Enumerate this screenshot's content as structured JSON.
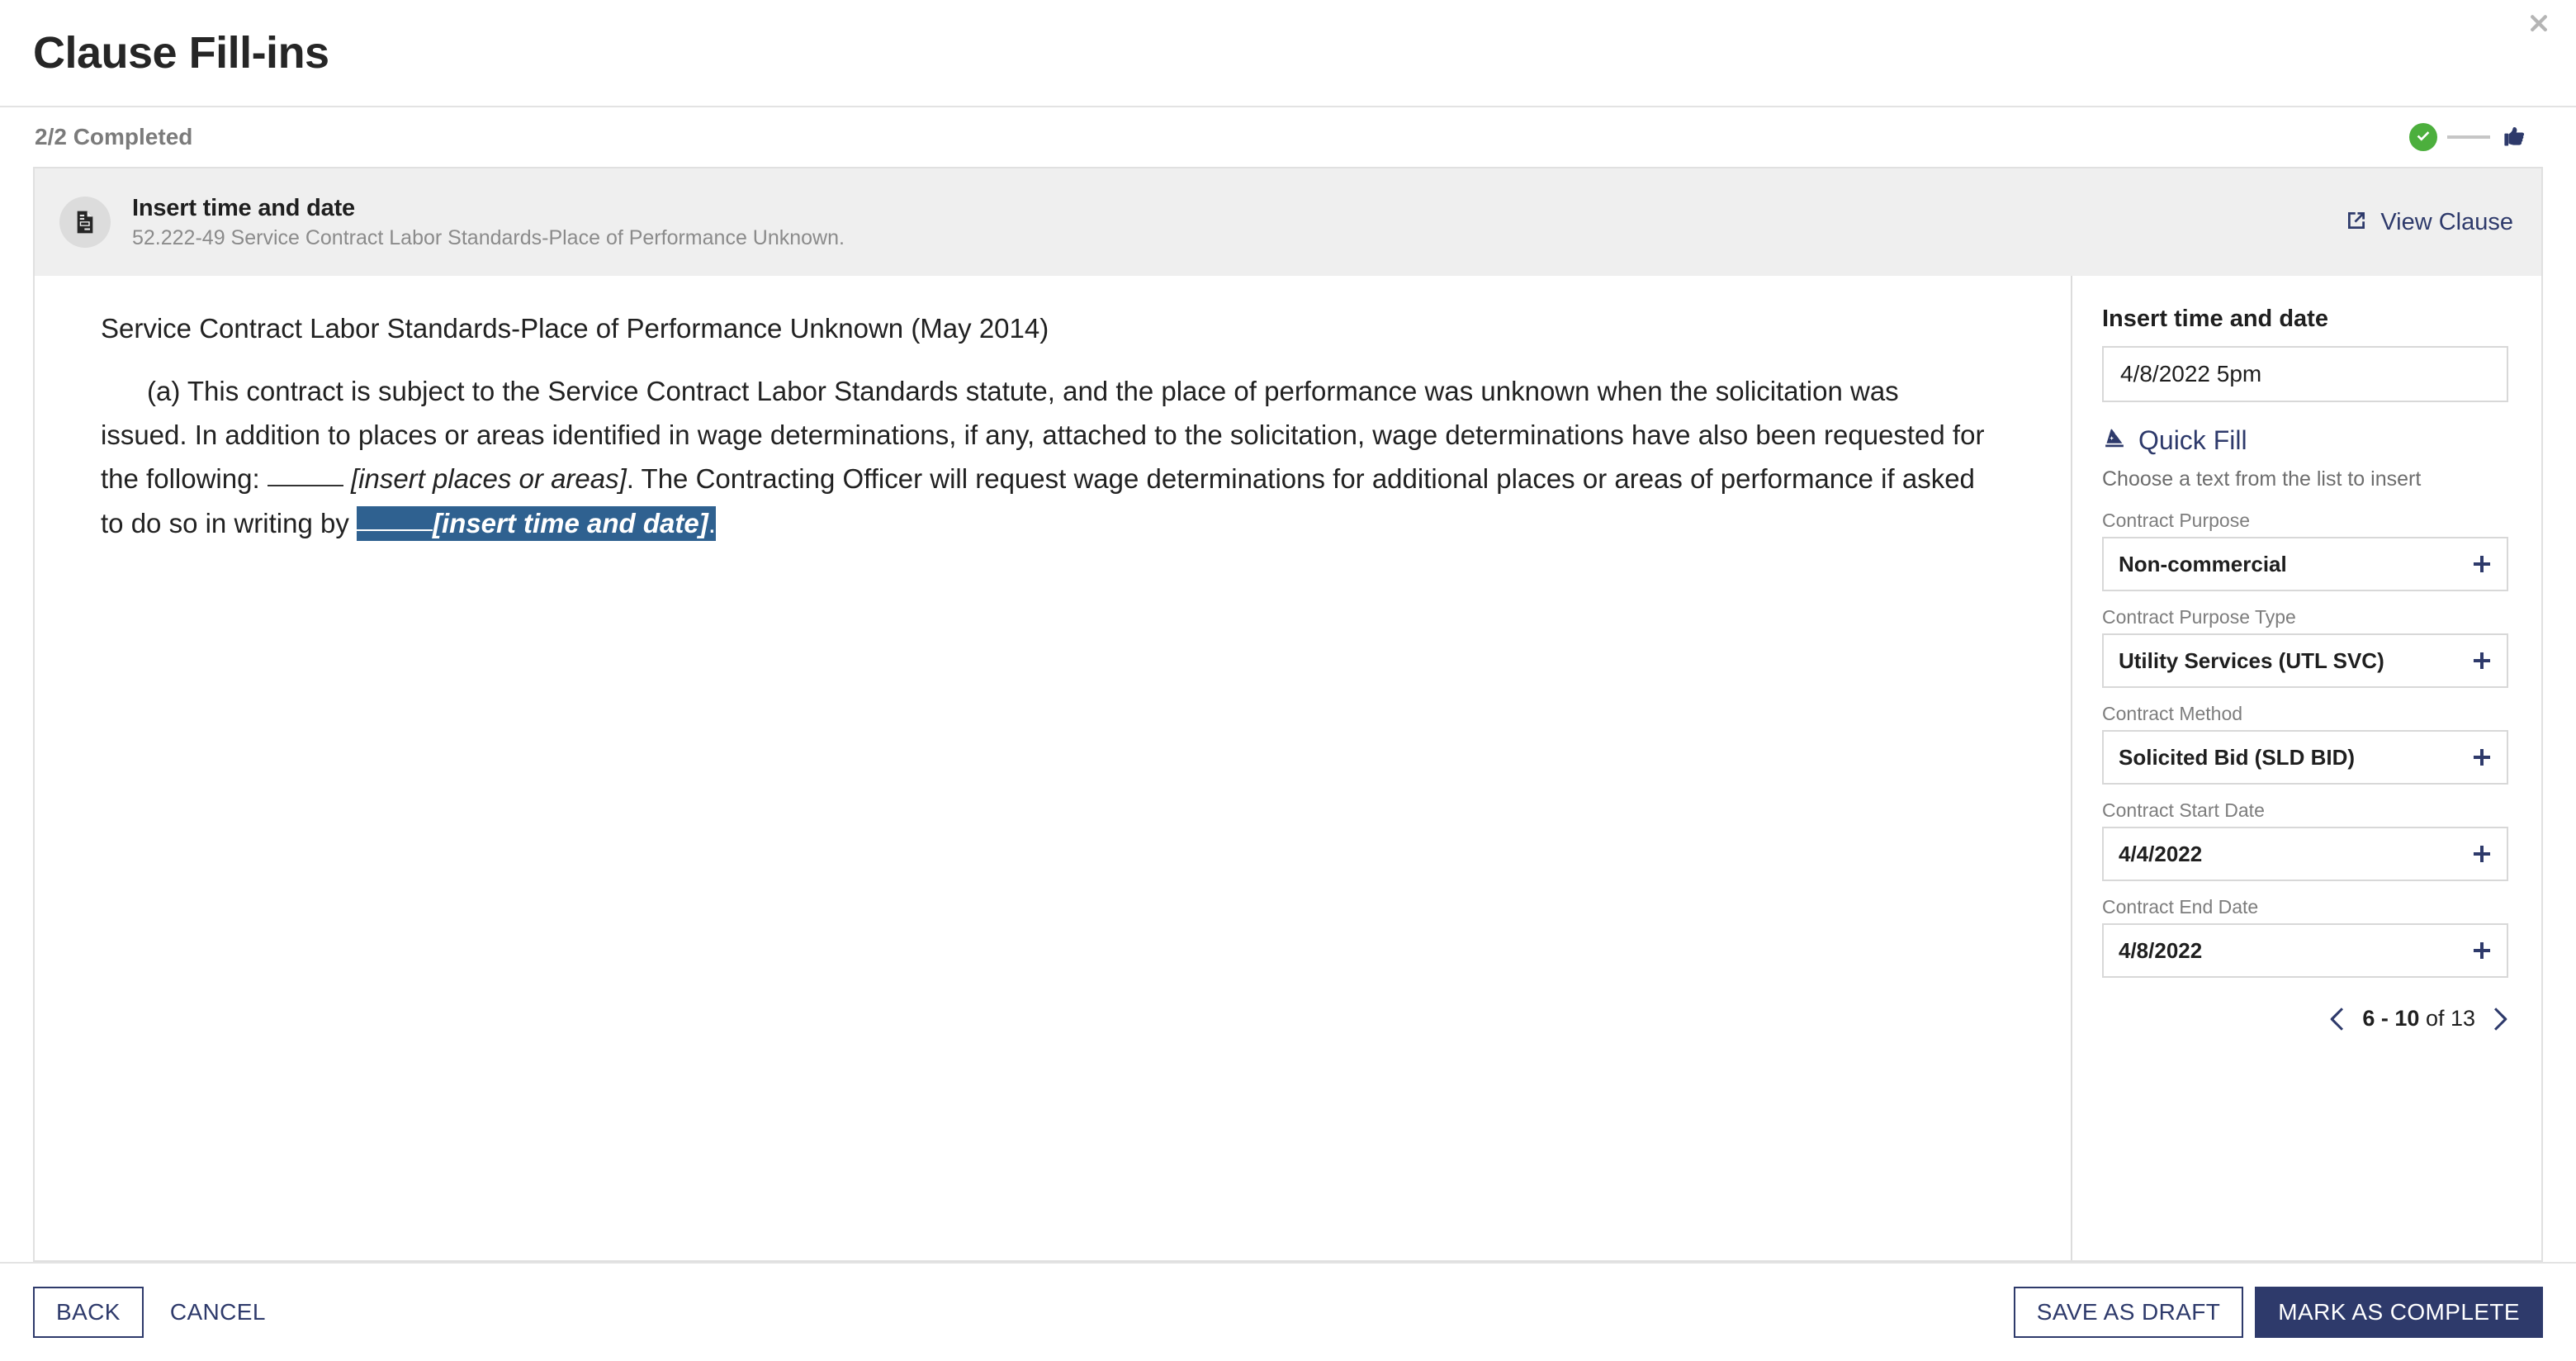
{
  "modal": {
    "title": "Clause Fill-ins",
    "close_icon": "close-icon"
  },
  "progress": {
    "label": "2/2 Completed",
    "completed_icon": "check-circle-icon",
    "pending_icon": "pointing-hand-icon",
    "accent_green": "#4caf3d",
    "accent_navy": "#2e3a6b"
  },
  "clause_header": {
    "icon": "document-icon",
    "title": "Insert time and date",
    "subtitle": "52.222-49 Service Contract Labor Standards-Place of Performance Unknown.",
    "view_clause_label": "View Clause",
    "view_clause_icon": "external-link-icon"
  },
  "document": {
    "heading": "Service Contract Labor Standards-Place of Performance Unknown (May 2014)",
    "paragraph": {
      "part1": "(a) This contract is subject to the Service Contract Labor Standards statute, and the place of performance was unknown when the solicitation was issued. In addition to places or areas identified in wage determinations, if any, attached to the solicitation, wage determinations have also been requested for the following: ",
      "bracket1": "[insert places or areas]",
      "part2": ". The Contracting Officer will request wage determinations for additional places or areas of performance if asked to do so in writing by ",
      "highlight_bracket": "[insert time and date]",
      "highlight_trailing": ".",
      "highlight_color": "#2f6190"
    }
  },
  "side_panel": {
    "title": "Insert time and date",
    "input_value": "4/8/2022 5pm",
    "input_placeholder": "Enter value",
    "quick_fill_label": "Quick Fill",
    "quick_fill_icon": "wizard-hat-icon",
    "hint": "Choose a text from the list to insert",
    "fields": [
      {
        "label": "Contract Purpose",
        "value": "Non-commercial",
        "action_icon": "plus-icon"
      },
      {
        "label": "Contract Purpose Type",
        "value": "Utility Services (UTL SVC)",
        "action_icon": "plus-icon"
      },
      {
        "label": "Contract Method",
        "value": "Solicited Bid (SLD BID)",
        "action_icon": "plus-icon"
      },
      {
        "label": "Contract Start Date",
        "value": "4/4/2022",
        "action_icon": "plus-icon"
      },
      {
        "label": "Contract End Date",
        "value": "4/8/2022",
        "action_icon": "plus-icon"
      }
    ],
    "pagination": {
      "range": "6 - 10",
      "suffix": " of 13",
      "prev_icon": "chevron-left-icon",
      "next_icon": "chevron-right-icon"
    }
  },
  "footer": {
    "back_label": "BACK",
    "cancel_label": "CANCEL",
    "save_draft_label": "SAVE AS DRAFT",
    "mark_complete_label": "MARK AS COMPLETE"
  }
}
